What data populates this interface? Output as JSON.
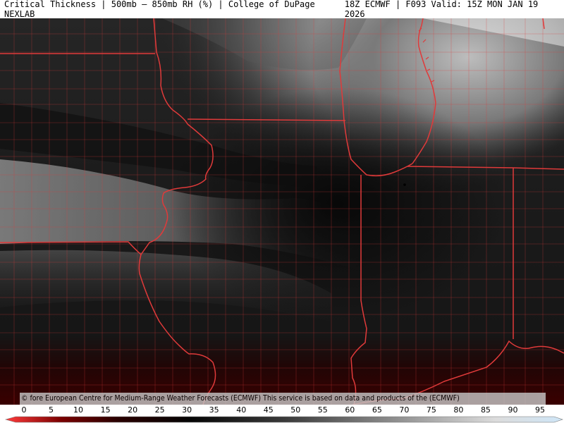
{
  "header": {
    "left_text": "Critical Thickness | 500mb – 850mb RH (%) | College of DuPage NEXLAB",
    "right_text": "18Z ECMWF | F093 Valid: 15Z MON JAN 19 2026"
  },
  "credit": "© fore European Centre for Medium-Range Weather Forecasts (ECMWF)  This service is based on data and products of the (ECMWF)",
  "legend": {
    "ticks": [
      "0",
      "5",
      "10",
      "15",
      "20",
      "25",
      "30",
      "35",
      "40",
      "45",
      "50",
      "55",
      "60",
      "65",
      "70",
      "75",
      "80",
      "85",
      "90",
      "95"
    ]
  },
  "colors": {
    "boundary": "#e03a3a",
    "low_rh": "#7a0000",
    "mid_rh": "#141414",
    "high_rh": "#e0e0e0",
    "max_rh": "#cfe6f7"
  }
}
